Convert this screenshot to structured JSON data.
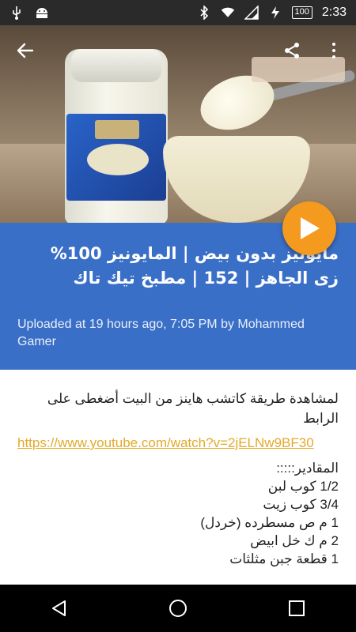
{
  "status_bar": {
    "left_icons": [
      "usb-icon",
      "android-icon"
    ],
    "right_icons": [
      "bluetooth-icon",
      "wifi-icon",
      "signal-icon",
      "charging-icon"
    ],
    "battery": "100",
    "time": "2:33"
  },
  "video": {
    "title": "مايونيز بدون بيض | المايونيز 100% زى الجاهز | 152 | مطبخ تيك تاك",
    "uploaded": "Uploaded at 19 hours ago, 7:05 PM by Mohammed Gamer"
  },
  "description": {
    "intro": "لمشاهدة طريقة كاتشب هاينز من البيت أضغطى على الرابط",
    "link": "https://www.youtube.com/watch?v=2jELNw9BF30",
    "ingredients_heading": "المقادير:::::",
    "ingredients": [
      "1/2 كوب لبن",
      "3/4 كوب زيت",
      "1 م ص مسطرده (خردل)",
      "2 م ك خل ابيض",
      "1 قطعة جبن مثلثات"
    ]
  },
  "colors": {
    "accent_blue": "#3a6fc7",
    "play_orange": "#f49a1f",
    "link_color": "#e4a92a"
  },
  "nav": [
    "back-nav-icon",
    "home-nav-icon",
    "recents-nav-icon"
  ]
}
